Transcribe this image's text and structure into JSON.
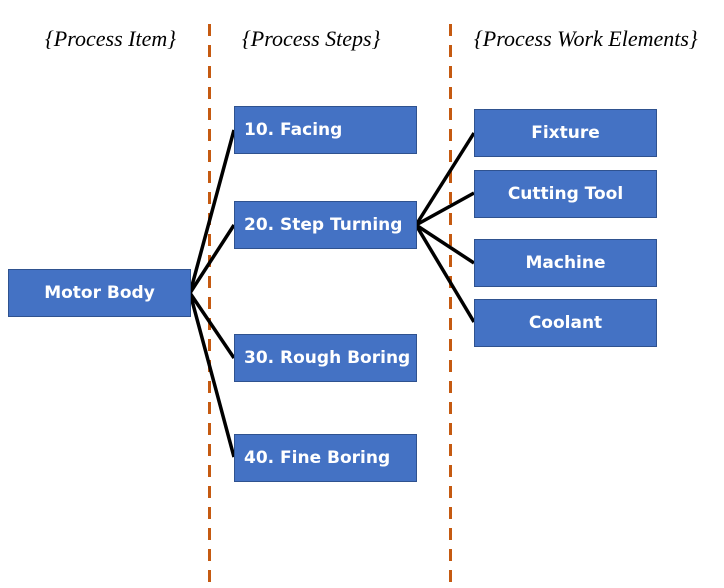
{
  "headers": {
    "process_item": "{Process Item}",
    "process_steps": "{Process Steps}",
    "process_work_elements": "{Process Work Elements}"
  },
  "process_item": {
    "label": "Motor Body"
  },
  "process_steps": [
    {
      "label": "10.  Facing"
    },
    {
      "label": "20. Step Turning"
    },
    {
      "label": "30. Rough Boring"
    },
    {
      "label": "40. Fine Boring"
    }
  ],
  "work_elements_parent": "20. Step Turning",
  "work_elements": [
    {
      "label": "Fixture"
    },
    {
      "label": "Cutting Tool"
    },
    {
      "label": "Machine"
    },
    {
      "label": "Coolant"
    }
  ],
  "colors": {
    "box_fill": "#4472c4",
    "box_border": "#2f528f",
    "divider": "#c55a11",
    "connector": "#000000"
  }
}
